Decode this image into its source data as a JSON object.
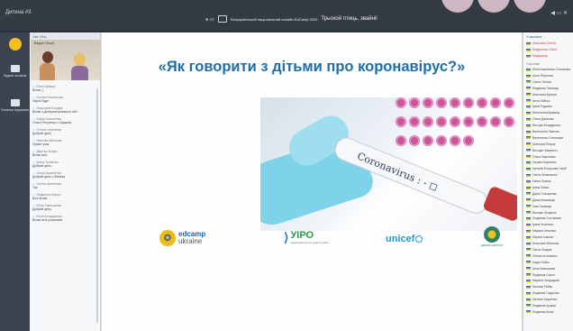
{
  "window": {
    "title": "Дитина #3",
    "banner_small": "Всеукраїнський національний онлайн EdCamp 2020",
    "tagline": "Трьохой птиць, звайні!",
    "right_controls": "◀ ▭ ✕"
  },
  "nav": {
    "items": [
      {
        "label": "Задати питання",
        "icon": "chat-icon"
      },
      {
        "label": "Технічна підтримка",
        "icon": "support-icon"
      }
    ]
  },
  "chat": {
    "header": "Чат (Усі)",
    "video_label": "Ведучі: Ольга",
    "messages": [
      {
        "who": "Юлія Шевчук",
        "text": "Вітаю :)"
      },
      {
        "who": "Оксана Ковальчук",
        "text": "Зараз буде"
      },
      {
        "who": "Анастасія Бондар",
        "text": "Вітаю з Дніпропетровської обл."
      },
      {
        "who": "Марія Коваленко",
        "text": "Ольга Петренко з Харкова"
      },
      {
        "who": "Тетяна Черненко",
        "text": "Добрий день"
      },
      {
        "who": "Наталія Мельник",
        "text": "Привіт усім"
      },
      {
        "who": "Дмитро Бойко",
        "text": "Вітаю всіх"
      },
      {
        "who": "Ірина Ткаченко",
        "text": "Добрий день"
      },
      {
        "who": "Ольга Кравченко",
        "text": "Добрий день з Вінниці"
      },
      {
        "who": "Олена Шевченко",
        "text": "Так"
      },
      {
        "who": "Людмила Мороз",
        "text": "Всіх вітаю"
      },
      {
        "who": "Юлія Тимошенко",
        "text": "Добрий день"
      },
      {
        "who": "Юлія Бондаренко",
        "text": "Вітаю всіх учасників"
      }
    ]
  },
  "slide": {
    "heading": "«Як говорити з дітьми про коронавірус?»",
    "tube_label": "Coronavirus : - ◻",
    "logos": {
      "edcamp": "edcamp",
      "edcamp_sub": "ukraine",
      "uipo": "УІРО",
      "uipo_sub": "Український інститут розвитку освіти",
      "unicef": "unicef",
      "ka_label": "ЕДКЕМП КАРАНТИН"
    }
  },
  "participants": {
    "header": "Учасники",
    "hosts": [
      "Анастасія Олена",
      "Модератор Ольга",
      "Модератор"
    ],
    "section_label": "Учасники",
    "list": [
      "Юлія Коваленко Стаханова",
      "Алла Петренко",
      "Ольга Сенько",
      "Людмила Пономар",
      "Анастасія Кучера",
      "Алла Зайчук",
      "Ірина Руденко",
      "Валентина Кравець",
      "Ольга Данилюк",
      "Вікторія Бондаренко",
      "Валентина Лисенко",
      "Валентина Степанова",
      "Світлана Петрик",
      "Вікторія Лавренко",
      "Ольга Мартинюк",
      "Оксана Карпенко",
      "Наталія Білоусова Голуб",
      "Ганна Литвиненко",
      "Ганна Гнатюк",
      "Ірина Лойко",
      "Дарія Гончаренко",
      "Діана Ковальчук",
      "Інна Паламар",
      "Вікторія Лещенко",
      "Людмила Солтанова",
      "Ірина Ігнатенко",
      "Марина Зінченко",
      "Лариса Ісаєнко",
      "Анастасія Мельник",
      "Ганна Осадча",
      "Тетяна Антоненко",
      "Надія Бойко",
      "Анна Ковальова",
      "Людмила Сокол",
      "Марина Свиридова",
      "Наталія Рибак",
      "Людмила Гордієнко",
      "Наталія Харченко",
      "Людмила Кушнір",
      "Людмила Білик"
    ]
  },
  "colors": {
    "topbar": "#343b45",
    "heading": "#1f6ea8",
    "nav_bg": "#3c4450",
    "host_text": "#d33333"
  }
}
